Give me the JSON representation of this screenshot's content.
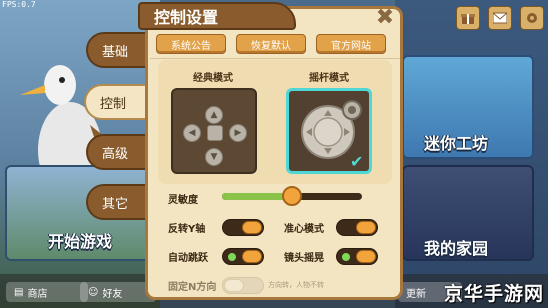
{
  "debug": {
    "fps_text": "FPS:0.7"
  },
  "background": {
    "left_card_title": "开始游戏",
    "right_card_1_title": "迷你工坊",
    "right_card_2_title": "我的家园"
  },
  "bottom_bar": {
    "shop_label": "商店",
    "friends_label": "好友",
    "update_label": "更新"
  },
  "tabs": [
    {
      "label": "基础",
      "active": false
    },
    {
      "label": "控制",
      "active": true
    },
    {
      "label": "高级",
      "active": false
    },
    {
      "label": "其它",
      "active": false
    }
  ],
  "panel": {
    "title": "控制设置",
    "buttons": {
      "announcement": "系统公告",
      "restore_default": "恢复默认",
      "official_site": "官方网站"
    },
    "modes": {
      "classic_label": "经典模式",
      "joystick_label": "摇杆模式",
      "selected": "摇杆模式"
    },
    "sensitivity": {
      "label": "灵敏度",
      "value": 0.5
    },
    "toggles": {
      "invert_y": {
        "label": "反转Y轴",
        "on": false
      },
      "crosshair": {
        "label": "准心模式",
        "on": false
      },
      "auto_jump": {
        "label": "自动跳跃",
        "on": true
      },
      "camera_shake": {
        "label": "镜头摇晃",
        "on": true
      },
      "fixed_direction": {
        "label": "固定N方向",
        "on": false
      }
    },
    "fixed_hint": "方向转，人物不转"
  },
  "watermark": "京华手游网",
  "colors": {
    "accent": "#e1a24a",
    "selected_border": "#4fd7d5",
    "toggle_on": "#7ed957"
  }
}
